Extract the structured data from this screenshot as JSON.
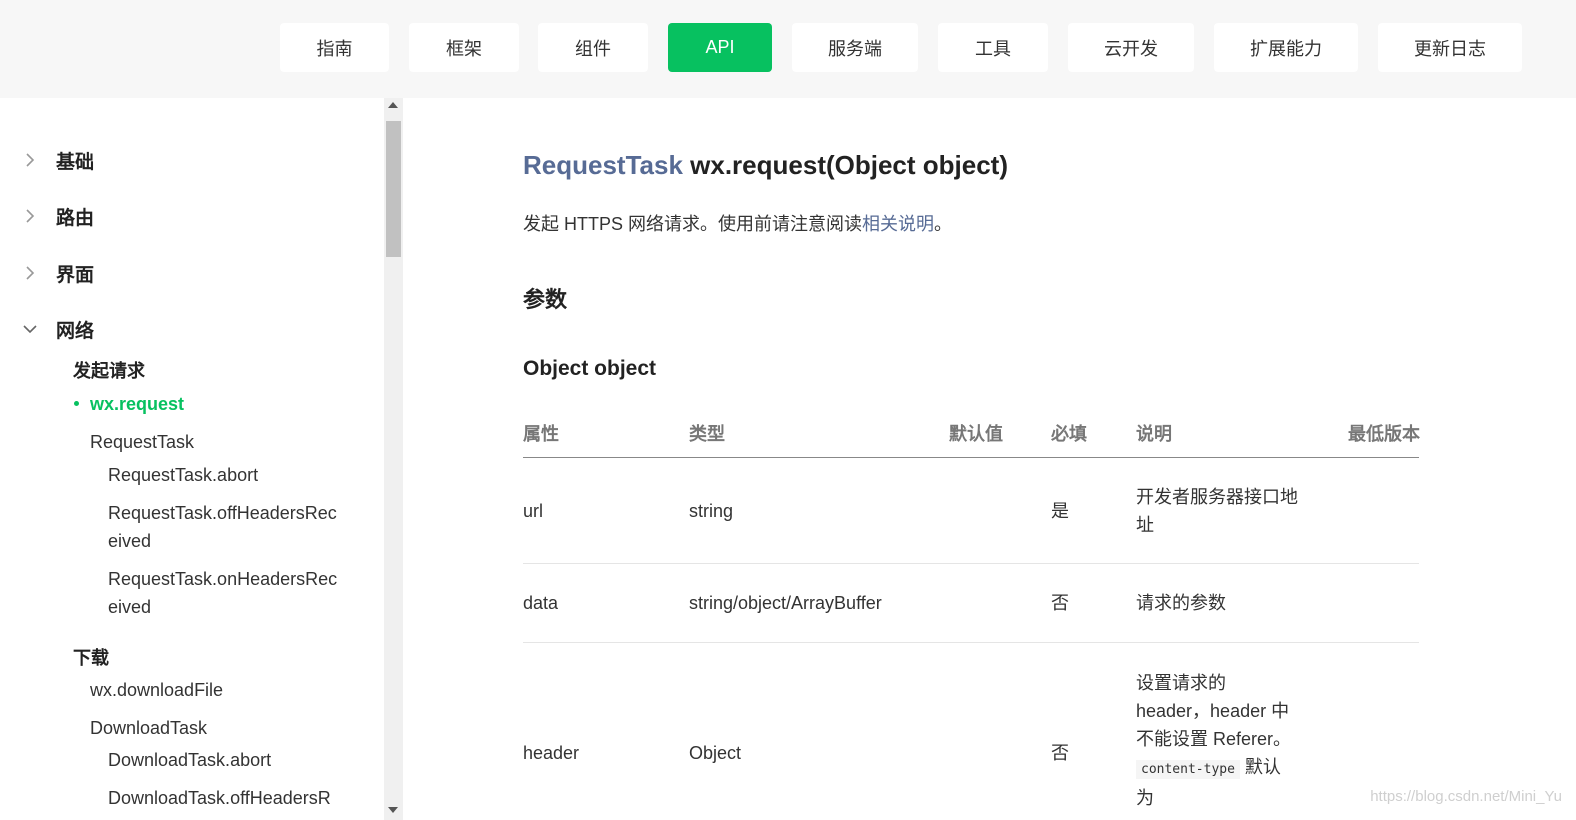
{
  "nav": {
    "items": [
      "指南",
      "框架",
      "组件",
      "API",
      "服务端",
      "工具",
      "云开发",
      "扩展能力",
      "更新日志"
    ],
    "active": "API"
  },
  "sidebar": {
    "groups": [
      {
        "label": "基础",
        "expanded": false
      },
      {
        "label": "路由",
        "expanded": false
      },
      {
        "label": "界面",
        "expanded": false
      },
      {
        "label": "网络",
        "expanded": true
      }
    ],
    "network": {
      "heading_request": "发起请求",
      "current": "wx.request",
      "request_task": "RequestTask",
      "abort": "RequestTask.abort",
      "off_headers": [
        "RequestTask.offHeadersRec",
        "eived"
      ],
      "on_headers": [
        "RequestTask.onHeadersRec",
        "eived"
      ],
      "heading_download": "下载",
      "download_file": "wx.downloadFile",
      "download_task": "DownloadTask",
      "download_abort": "DownloadTask.abort",
      "download_off_headers": "DownloadTask.offHeadersR"
    }
  },
  "main": {
    "title_return": "RequestTask",
    "title_sig": " wx.request(Object object)",
    "desc_prefix": "发起 HTTPS 网络请求。使用前请注意阅读",
    "desc_link": "相关说明",
    "desc_suffix": "。",
    "h_params": "参数",
    "h_object": "Object object"
  },
  "table": {
    "headers": [
      "属性",
      "类型",
      "默认值",
      "必填",
      "说明",
      "最低版本"
    ],
    "rows": [
      {
        "attr": "url",
        "type": "string",
        "default": "",
        "required": "是",
        "desc": [
          "开发者服务器接口地",
          "址"
        ]
      },
      {
        "attr": "data",
        "type": "string/object/ArrayBuffer",
        "default": "",
        "required": "否",
        "desc": [
          "请求的参数"
        ]
      },
      {
        "attr": "header",
        "type": "Object",
        "default": "",
        "required": "否",
        "desc": [
          "设置请求的",
          "header，header 中",
          "不能设置 Referer。"
        ],
        "desc_code": "content-type",
        "desc_code_after": " 默认",
        "desc_tail": "为"
      }
    ]
  },
  "watermark": "https://blog.csdn.net/Mini_Yu",
  "colors": {
    "accent": "#07c160",
    "link": "#576b95"
  },
  "icons": {
    "collapsed": "chevron-right-icon",
    "expanded": "chevron-down-icon",
    "bullet": "bullet-icon"
  }
}
